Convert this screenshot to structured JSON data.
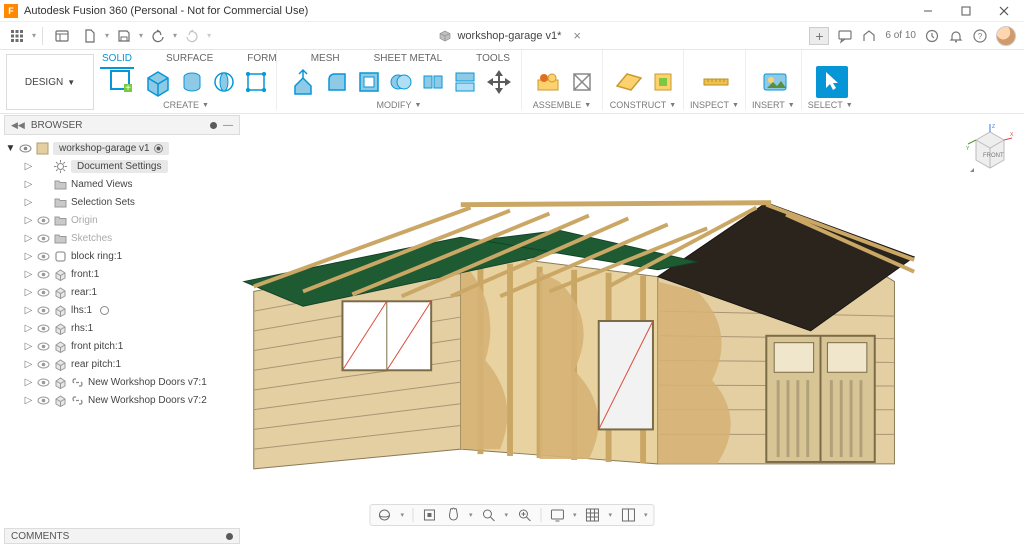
{
  "titlebar": {
    "app_icon": "F",
    "title": "Autodesk Fusion 360 (Personal - Not for Commercial Use)"
  },
  "doc_tab": {
    "name": "workshop-garage v1*"
  },
  "qat_right": {
    "jobs": "6 of 10"
  },
  "design_button": "DESIGN",
  "ribbon_tabs": [
    "SOLID",
    "SURFACE",
    "FORM",
    "MESH",
    "SHEET METAL",
    "TOOLS"
  ],
  "ribbon_groups": {
    "create": "CREATE",
    "modify": "MODIFY",
    "assemble": "ASSEMBLE",
    "construct": "CONSTRUCT",
    "inspect": "INSPECT",
    "insert": "INSERT",
    "select": "SELECT"
  },
  "browser": {
    "header": "BROWSER",
    "root": "workshop-garage v1",
    "items": [
      {
        "icon": "gear",
        "label": "Document Settings",
        "badge": true
      },
      {
        "icon": "folder",
        "label": "Named Views"
      },
      {
        "icon": "folder",
        "label": "Selection Sets"
      },
      {
        "icon": "folder",
        "label": "Origin",
        "eye": true,
        "dim": true
      },
      {
        "icon": "folder",
        "label": "Sketches",
        "eye": true,
        "dim": true
      },
      {
        "icon": "body",
        "label": "block ring:1",
        "eye": true
      },
      {
        "icon": "comp",
        "label": "front:1",
        "eye": true
      },
      {
        "icon": "comp",
        "label": "rear:1",
        "eye": true
      },
      {
        "icon": "comp",
        "label": "lhs:1",
        "eye": true,
        "extra_radio": true
      },
      {
        "icon": "comp",
        "label": "rhs:1",
        "eye": true
      },
      {
        "icon": "comp",
        "label": "front pitch:1",
        "eye": true
      },
      {
        "icon": "comp",
        "label": "rear pitch:1",
        "eye": true
      },
      {
        "icon": "link",
        "label": "New Workshop Doors v7:1",
        "eye": true,
        "double": true
      },
      {
        "icon": "link",
        "label": "New Workshop Doors v7:2",
        "eye": true,
        "double": true
      }
    ]
  },
  "comments": "COMMENTS",
  "viewcube": {
    "face": "FRONT"
  }
}
